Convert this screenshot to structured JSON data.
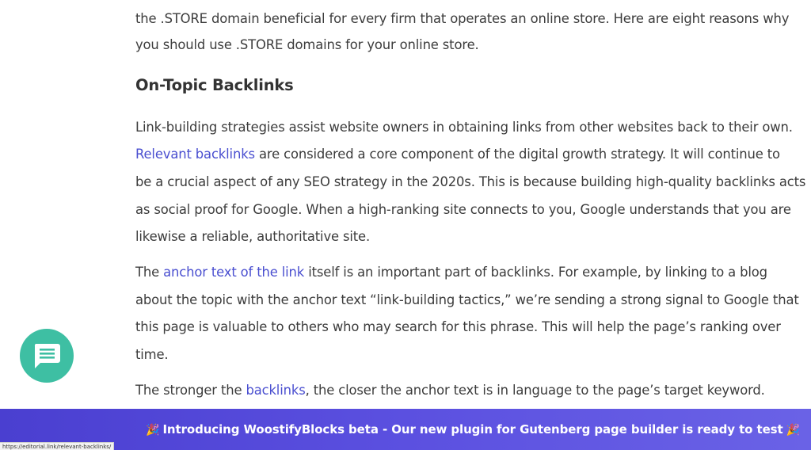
{
  "article": {
    "intro": {
      "line1": "the .STORE domain beneficial for every firm that operates an online store. Here are eight reasons why",
      "line2": "you should use .STORE domains for your online store."
    },
    "heading": "On-Topic Backlinks",
    "para1": {
      "line1": "Link-building strategies assist website owners in obtaining links from other websites back to their own.",
      "line2_link": "Relevant backlinks",
      "line2_rest": " are considered a core component of the digital growth strategy. It will continue to",
      "line3": "be a crucial aspect of any SEO strategy in the 2020s. This is because building high-quality backlinks acts",
      "line4": "as social proof for Google. When a high-ranking site connects to you, Google understands that you are",
      "line5": "likewise a reliable, authoritative site."
    },
    "para2": {
      "line1_pre": "The ",
      "line1_link": "anchor text of the link",
      "line1_rest": " itself is an important part of backlinks. For example, by linking to a blog",
      "line2": "about the topic with the anchor text “link-building tactics,” we’re sending a strong signal to Google that",
      "line3": "this page is valuable to others who may search for this phrase. This will help the page’s ranking over",
      "line4": "time."
    },
    "para3": {
      "pre": "The stronger the ",
      "link": "backlinks",
      "rest": ", the closer the anchor text is in language to the page’s target keyword."
    }
  },
  "chat": {
    "icon": "chat-bubble-icon",
    "color": "#3ebfa3"
  },
  "banner": {
    "emoji": "🎉",
    "text": "Introducing WoostifyBlocks beta - Our new plugin for Gutenberg page builder is ready to test",
    "color_start": "#4a3fd0",
    "color_end": "#6a62e6"
  },
  "status_bar": {
    "url": "https://editorial.link/relevant-backlinks/"
  }
}
